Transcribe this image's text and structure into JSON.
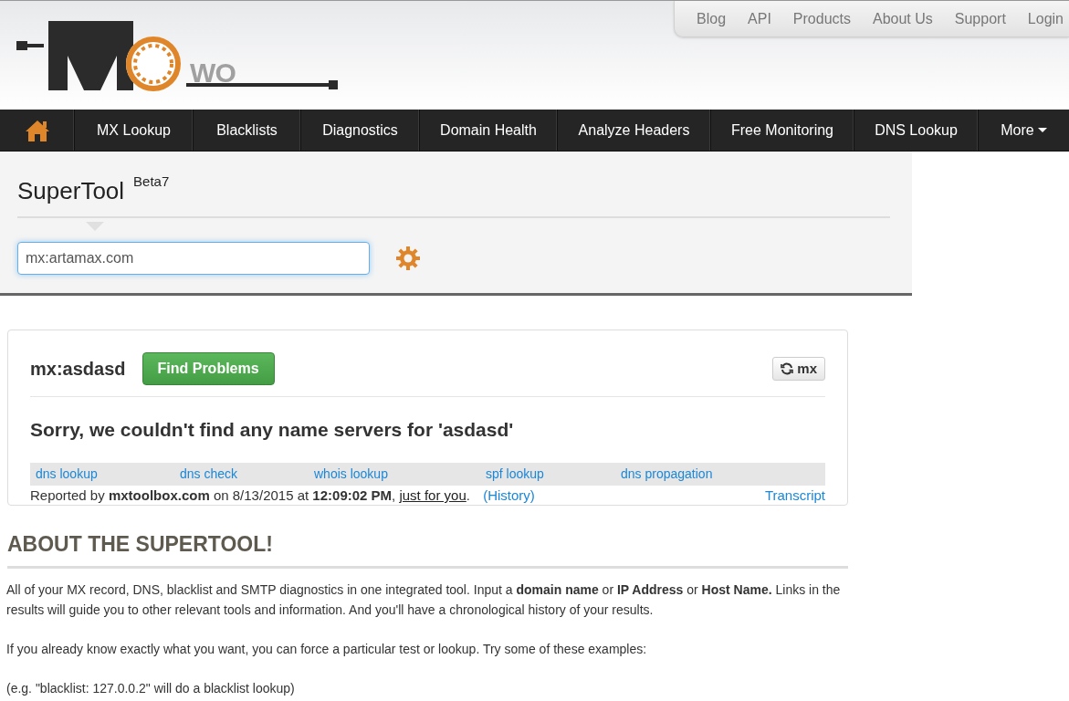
{
  "logo": {
    "text": "WO"
  },
  "top_links": [
    "Blog",
    "API",
    "Products",
    "About Us",
    "Support",
    "Login"
  ],
  "nav": {
    "items": [
      {
        "kind": "home"
      },
      {
        "kind": "link",
        "label": "MX Lookup"
      },
      {
        "kind": "link",
        "label": "Blacklists"
      },
      {
        "kind": "link",
        "label": "Diagnostics"
      },
      {
        "kind": "link",
        "label": "Domain Health"
      },
      {
        "kind": "link",
        "label": "Analyze Headers"
      },
      {
        "kind": "link",
        "label": "Free Monitoring"
      },
      {
        "kind": "link",
        "label": "DNS Lookup"
      },
      {
        "kind": "dropdown",
        "label": "More"
      }
    ]
  },
  "supertool": {
    "title": "SuperTool",
    "badge": "Beta7",
    "input_value": "mx:artamax.com"
  },
  "result": {
    "query": "mx:asdasd",
    "find_button": "Find Problems",
    "refresh_button": "mx",
    "message": "Sorry, we couldn't find any name servers for 'asdasd'",
    "links": [
      "dns lookup",
      "dns check",
      "whois lookup",
      "spf lookup",
      "dns propagation"
    ],
    "report": {
      "text": "Reported by **mxtoolbox.com** on 8/13/2015 at **12:09:02 PM**,",
      "link": "just for you",
      "after": ".",
      "history": "(History)",
      "transcript": "Transcript"
    }
  },
  "about": {
    "heading": "ABOUT THE SUPERTOOL!",
    "paragraphs": [
      "All of your MX record, DNS, blacklist and SMTP diagnostics in one integrated tool.  Input a **domain name** or **IP Address** or **Host Name.** Links in the results will guide you to other relevant tools and information.  And you'll have a chronological history of your results.",
      "If you already know exactly what you want, you can force a particular test or lookup.  Try some of these examples:",
      "(e.g. \"blacklist: 127.0.0.2\" will do a blacklist lookup)"
    ]
  }
}
